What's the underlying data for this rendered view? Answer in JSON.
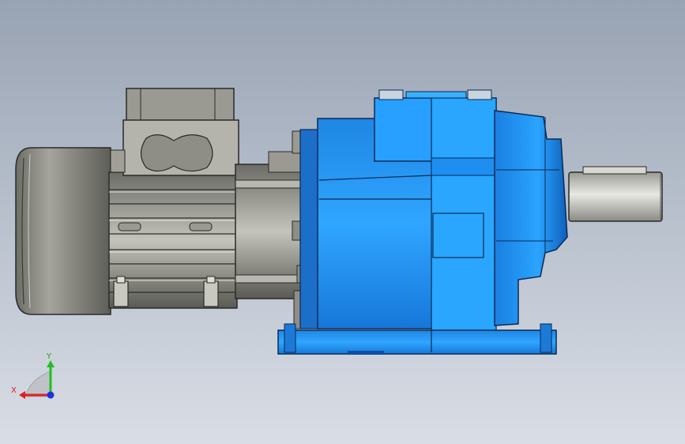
{
  "scene": {
    "background_top": "#98a3b3",
    "background_bottom": "#d9dde5",
    "model": "gear-motor",
    "motor_color": "#8f8f86",
    "gearbox_color": "#1e8ff0"
  },
  "triad": {
    "x_label": "X",
    "y_label": "Y",
    "x_color": "#e02020",
    "y_color": "#20c020",
    "z_color": "#2030e0"
  }
}
